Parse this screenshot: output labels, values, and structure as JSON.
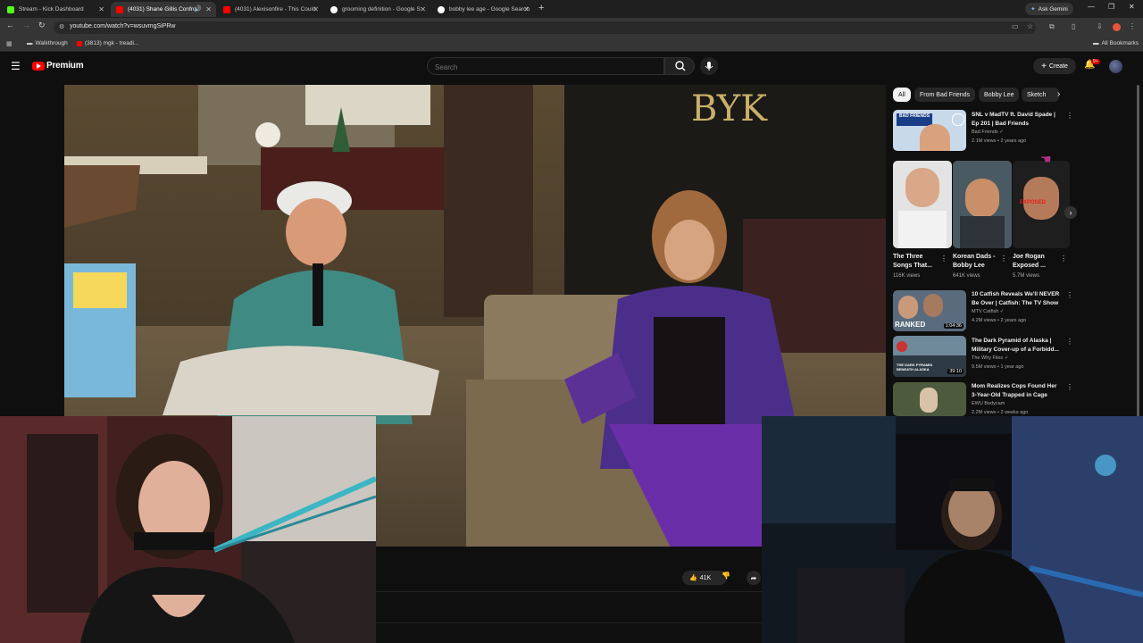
{
  "browser": {
    "tabs": [
      {
        "label": "Stream - Kick Dashboard",
        "favicon_color": "#53fc18"
      },
      {
        "label": "(4031) Shane Gillis Confron",
        "favicon_color": "#ff0000"
      },
      {
        "label": "(4031) Alexisonfire - This Could",
        "favicon_color": "#ff0000"
      },
      {
        "label": "grooming definition - Google S",
        "favicon_color": "#ffffff"
      },
      {
        "label": "bobby lee age - Google Search",
        "favicon_color": "#ffffff"
      }
    ],
    "active_tab_index": 1,
    "ask_gemini_label": "Ask Gemini",
    "url": "youtube.com/watch?v=wsuvmgSiPRw",
    "bookmarks": [
      {
        "label": "Walkthrough"
      },
      {
        "label": "(3813) mgk - treadi..."
      }
    ],
    "all_bookmarks_label": "All Bookmarks"
  },
  "youtube": {
    "brand": "Premium",
    "search_placeholder": "Search",
    "create_label": "Create",
    "notification_count": "9+",
    "chips": [
      "All",
      "From Bad Friends",
      "Bobby Lee",
      "Sketch"
    ],
    "like_count": "41K",
    "related": [
      {
        "title": "SNL v MadTV ft. David Spade | Ep 201 | Bad Friends",
        "channel": "Bad Friends",
        "meta": "2.1M views • 2 years ago",
        "duration": ""
      },
      {
        "title": "10 Catfish Reveals We'll NEVER Be Over | Catfish: The TV Show",
        "channel": "MTV Catfish",
        "meta": "4.2M views • 2 years ago",
        "duration": "1:04:36"
      },
      {
        "title": "The Dark Pyramid of Alaska | Military Cover-up of a Forbidd...",
        "channel": "The Why Files",
        "meta": "9.5M views • 1 year ago",
        "duration": "39:10"
      },
      {
        "title": "Mom Realizes Cops Found Her 3-Year-Old Trapped in Cage",
        "channel": "EWU Bodycam",
        "meta": "2.2M views • 2 weeks ago",
        "duration": ""
      }
    ],
    "shorts": [
      {
        "title": "The Three Songs That...",
        "views": "116K views"
      },
      {
        "title": "Korean Dads - Bobby Lee",
        "views": "641K views"
      },
      {
        "title": "Joe Rogan Exposed ...",
        "views": "5.7M views"
      }
    ],
    "thumb_texts": {
      "bad_friends": "BAD FRIENDS",
      "ranked": "RANKED",
      "dark_pyramid": "THE DARK PYRAMID BENEATH ALASKA",
      "exposed": "EXPOSED"
    },
    "video_sign": "BYK"
  }
}
